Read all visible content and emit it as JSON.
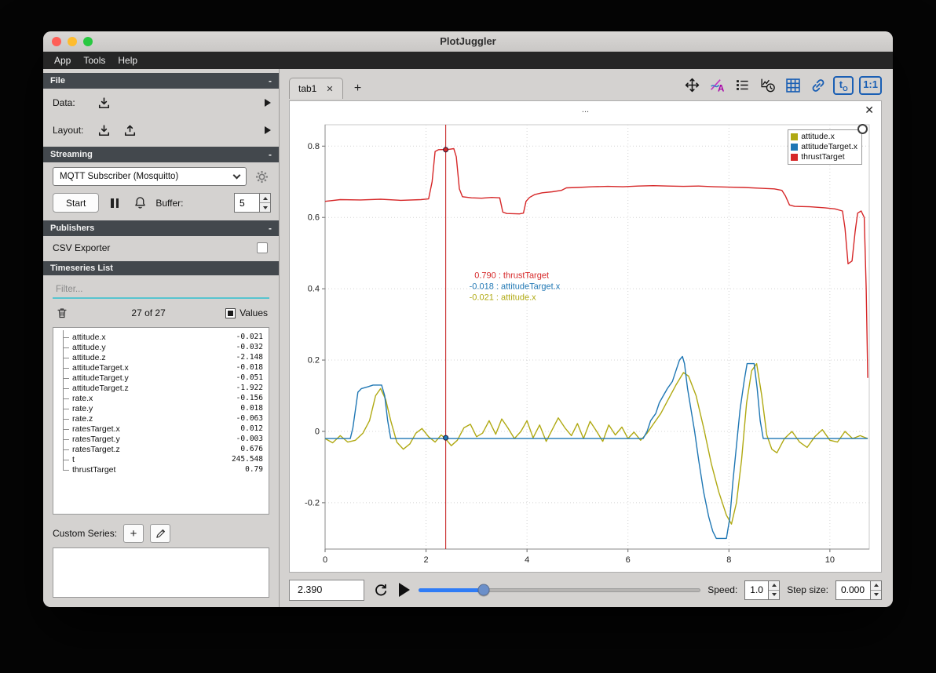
{
  "ui": {
    "collapse_symbol": "-",
    "close_symbol": "✕",
    "plus_symbol": "+",
    "plot_title": "..."
  },
  "window": {
    "title": "PlotJuggler",
    "menu_items": [
      "App",
      "Tools",
      "Help"
    ]
  },
  "sidebar": {
    "file_section": {
      "title": "File",
      "data_label": "Data:",
      "layout_label": "Layout:"
    },
    "streaming_section": {
      "title": "Streaming",
      "source_selected": "MQTT Subscriber (Mosquitto)",
      "start_button": "Start",
      "buffer_label": "Buffer:",
      "buffer_value": "5"
    },
    "publishers_section": {
      "title": "Publishers",
      "csv_exporter_label": "CSV Exporter"
    },
    "timeseries_section": {
      "title": "Timeseries List",
      "filter_placeholder": "Filter...",
      "count_text": "27 of 27",
      "values_label": "Values"
    },
    "series_list": [
      {
        "name": "attitude.x",
        "value": "-0.021"
      },
      {
        "name": "attitude.y",
        "value": "-0.032"
      },
      {
        "name": "attitude.z",
        "value": "-2.148"
      },
      {
        "name": "attitudeTarget.x",
        "value": "-0.018"
      },
      {
        "name": "attitudeTarget.y",
        "value": "-0.051"
      },
      {
        "name": "attitudeTarget.z",
        "value": "-1.922"
      },
      {
        "name": "rate.x",
        "value": "-0.156"
      },
      {
        "name": "rate.y",
        "value": "0.018"
      },
      {
        "name": "rate.z",
        "value": "-0.063"
      },
      {
        "name": "ratesTarget.x",
        "value": "0.012"
      },
      {
        "name": "ratesTarget.y",
        "value": "-0.003"
      },
      {
        "name": "ratesTarget.z",
        "value": "0.676"
      },
      {
        "name": "t",
        "value": "245.548"
      },
      {
        "name": "thrustTarget",
        "value": "0.79"
      }
    ],
    "custom_series_label": "Custom Series:"
  },
  "main": {
    "tab_label": "tab1"
  },
  "icons": {
    "t0_text": "t",
    "t0_sub": "O",
    "ratio_text": "1:1"
  },
  "playback": {
    "time_value": "2.390",
    "speed_label": "Speed:",
    "speed_value": "1.0",
    "step_label": "Step size:",
    "step_value": "0.000"
  },
  "chart_data": {
    "type": "line",
    "title": "...",
    "xlabel": "",
    "ylabel": "",
    "xlim": [
      0,
      10.78
    ],
    "ylim": [
      -0.33,
      0.86
    ],
    "xticks": [
      0,
      2,
      4,
      6,
      8,
      10
    ],
    "yticks": [
      -0.2,
      0,
      0.2,
      0.4,
      0.6,
      0.8
    ],
    "grid": true,
    "legend_position": "top-right",
    "legend": [
      {
        "name": "attitude.x",
        "color": "#b0a912"
      },
      {
        "name": "attitudeTarget.x",
        "color": "#1f77b4"
      },
      {
        "name": "thrustTarget",
        "color": "#d62728"
      }
    ],
    "tracker": {
      "x": 2.39,
      "labels": [
        {
          "text": "0.790 : thrustTarget",
          "color": "#d62728"
        },
        {
          "text": "-0.018 : attitudeTarget.x",
          "color": "#1f77b4"
        },
        {
          "text": "-0.021 : attitude.x",
          "color": "#b0a912"
        }
      ],
      "points": [
        {
          "y": 0.79,
          "color": "#d62728"
        },
        {
          "y": -0.018,
          "color": "#1f77b4"
        }
      ]
    },
    "series": [
      {
        "name": "attitude.x",
        "color": "#b0a912",
        "points": [
          [
            0,
            -0.02
          ],
          [
            0.15,
            -0.032
          ],
          [
            0.3,
            -0.012
          ],
          [
            0.45,
            -0.03
          ],
          [
            0.6,
            -0.025
          ],
          [
            0.75,
            -0.005
          ],
          [
            0.88,
            0.03
          ],
          [
            1.0,
            0.1
          ],
          [
            1.1,
            0.12
          ],
          [
            1.2,
            0.09
          ],
          [
            1.3,
            0.03
          ],
          [
            1.42,
            -0.03
          ],
          [
            1.55,
            -0.05
          ],
          [
            1.68,
            -0.035
          ],
          [
            1.8,
            -0.005
          ],
          [
            1.92,
            0.008
          ],
          [
            2.05,
            -0.015
          ],
          [
            2.18,
            -0.03
          ],
          [
            2.3,
            -0.01
          ],
          [
            2.39,
            -0.021
          ],
          [
            2.5,
            -0.04
          ],
          [
            2.62,
            -0.025
          ],
          [
            2.75,
            0.01
          ],
          [
            2.88,
            0.02
          ],
          [
            3.0,
            -0.015
          ],
          [
            3.12,
            -0.005
          ],
          [
            3.25,
            0.03
          ],
          [
            3.38,
            -0.008
          ],
          [
            3.5,
            0.035
          ],
          [
            3.62,
            0.01
          ],
          [
            3.75,
            -0.02
          ],
          [
            3.88,
            0.0
          ],
          [
            4.0,
            0.03
          ],
          [
            4.12,
            -0.018
          ],
          [
            4.25,
            0.018
          ],
          [
            4.38,
            -0.028
          ],
          [
            4.5,
            0.005
          ],
          [
            4.62,
            0.038
          ],
          [
            4.75,
            0.01
          ],
          [
            4.88,
            -0.012
          ],
          [
            5.0,
            0.022
          ],
          [
            5.12,
            -0.02
          ],
          [
            5.25,
            0.028
          ],
          [
            5.38,
            0.0
          ],
          [
            5.5,
            -0.028
          ],
          [
            5.62,
            0.018
          ],
          [
            5.75,
            -0.01
          ],
          [
            5.88,
            0.012
          ],
          [
            6.0,
            -0.02
          ],
          [
            6.12,
            -0.002
          ],
          [
            6.25,
            -0.025
          ],
          [
            6.38,
            -0.005
          ],
          [
            6.5,
            0.02
          ],
          [
            6.65,
            0.05
          ],
          [
            6.8,
            0.09
          ],
          [
            6.95,
            0.13
          ],
          [
            7.1,
            0.165
          ],
          [
            7.2,
            0.155
          ],
          [
            7.35,
            0.1
          ],
          [
            7.5,
            0.01
          ],
          [
            7.65,
            -0.09
          ],
          [
            7.8,
            -0.17
          ],
          [
            7.95,
            -0.235
          ],
          [
            8.05,
            -0.26
          ],
          [
            8.15,
            -0.2
          ],
          [
            8.25,
            -0.08
          ],
          [
            8.35,
            0.08
          ],
          [
            8.45,
            0.17
          ],
          [
            8.55,
            0.19
          ],
          [
            8.65,
            0.1
          ],
          [
            8.75,
            -0.01
          ],
          [
            8.85,
            -0.05
          ],
          [
            8.95,
            -0.06
          ],
          [
            9.1,
            -0.02
          ],
          [
            9.25,
            0.0
          ],
          [
            9.4,
            -0.03
          ],
          [
            9.55,
            -0.045
          ],
          [
            9.7,
            -0.015
          ],
          [
            9.85,
            0.005
          ],
          [
            10.0,
            -0.025
          ],
          [
            10.15,
            -0.03
          ],
          [
            10.3,
            0.0
          ],
          [
            10.45,
            -0.02
          ],
          [
            10.6,
            -0.012
          ],
          [
            10.75,
            -0.02
          ]
        ]
      },
      {
        "name": "attitudeTarget.x",
        "color": "#1f77b4",
        "points": [
          [
            0,
            -0.02
          ],
          [
            0.5,
            -0.02
          ],
          [
            0.55,
            0.01
          ],
          [
            0.6,
            0.06
          ],
          [
            0.65,
            0.11
          ],
          [
            0.72,
            0.12
          ],
          [
            0.85,
            0.125
          ],
          [
            0.95,
            0.13
          ],
          [
            1.12,
            0.13
          ],
          [
            1.18,
            0.1
          ],
          [
            1.24,
            0.03
          ],
          [
            1.3,
            -0.02
          ],
          [
            2.5,
            -0.02
          ],
          [
            4.0,
            -0.02
          ],
          [
            6.3,
            -0.02
          ],
          [
            6.38,
            0.0
          ],
          [
            6.45,
            0.03
          ],
          [
            6.55,
            0.05
          ],
          [
            6.62,
            0.08
          ],
          [
            6.7,
            0.1
          ],
          [
            6.78,
            0.12
          ],
          [
            6.88,
            0.14
          ],
          [
            6.95,
            0.17
          ],
          [
            7.02,
            0.2
          ],
          [
            7.08,
            0.21
          ],
          [
            7.12,
            0.19
          ],
          [
            7.18,
            0.12
          ],
          [
            7.25,
            0.06
          ],
          [
            7.32,
            0.0
          ],
          [
            7.4,
            -0.08
          ],
          [
            7.5,
            -0.17
          ],
          [
            7.6,
            -0.24
          ],
          [
            7.68,
            -0.28
          ],
          [
            7.75,
            -0.3
          ],
          [
            7.95,
            -0.3
          ],
          [
            8.02,
            -0.24
          ],
          [
            8.08,
            -0.14
          ],
          [
            8.15,
            -0.04
          ],
          [
            8.22,
            0.06
          ],
          [
            8.3,
            0.14
          ],
          [
            8.36,
            0.19
          ],
          [
            8.5,
            0.19
          ],
          [
            8.56,
            0.12
          ],
          [
            8.62,
            0.03
          ],
          [
            8.68,
            -0.02
          ],
          [
            10.75,
            -0.02
          ]
        ]
      },
      {
        "name": "thrustTarget",
        "color": "#d62728",
        "points": [
          [
            0,
            0.645
          ],
          [
            0.3,
            0.65
          ],
          [
            0.7,
            0.649
          ],
          [
            1.1,
            0.651
          ],
          [
            1.5,
            0.648
          ],
          [
            1.9,
            0.65
          ],
          [
            2.05,
            0.652
          ],
          [
            2.12,
            0.7
          ],
          [
            2.18,
            0.785
          ],
          [
            2.25,
            0.79
          ],
          [
            2.45,
            0.791
          ],
          [
            2.55,
            0.793
          ],
          [
            2.6,
            0.77
          ],
          [
            2.66,
            0.68
          ],
          [
            2.72,
            0.658
          ],
          [
            2.9,
            0.655
          ],
          [
            3.1,
            0.654
          ],
          [
            3.3,
            0.656
          ],
          [
            3.46,
            0.655
          ],
          [
            3.52,
            0.615
          ],
          [
            3.6,
            0.611
          ],
          [
            3.85,
            0.61
          ],
          [
            3.93,
            0.612
          ],
          [
            3.98,
            0.645
          ],
          [
            4.05,
            0.656
          ],
          [
            4.15,
            0.664
          ],
          [
            4.3,
            0.669
          ],
          [
            4.5,
            0.672
          ],
          [
            4.68,
            0.676
          ],
          [
            4.78,
            0.683
          ],
          [
            5.0,
            0.684
          ],
          [
            5.3,
            0.686
          ],
          [
            5.6,
            0.687
          ],
          [
            5.9,
            0.686
          ],
          [
            6.2,
            0.688
          ],
          [
            6.5,
            0.689
          ],
          [
            6.8,
            0.688
          ],
          [
            7.1,
            0.687
          ],
          [
            7.4,
            0.688
          ],
          [
            7.7,
            0.686
          ],
          [
            8.0,
            0.685
          ],
          [
            8.3,
            0.684
          ],
          [
            8.6,
            0.682
          ],
          [
            8.9,
            0.68
          ],
          [
            9.05,
            0.676
          ],
          [
            9.12,
            0.66
          ],
          [
            9.2,
            0.635
          ],
          [
            9.3,
            0.631
          ],
          [
            9.6,
            0.63
          ],
          [
            9.9,
            0.627
          ],
          [
            10.1,
            0.624
          ],
          [
            10.25,
            0.618
          ],
          [
            10.3,
            0.57
          ],
          [
            10.36,
            0.47
          ],
          [
            10.44,
            0.478
          ],
          [
            10.5,
            0.56
          ],
          [
            10.55,
            0.612
          ],
          [
            10.62,
            0.618
          ],
          [
            10.68,
            0.6
          ],
          [
            10.72,
            0.4
          ],
          [
            10.75,
            0.15
          ]
        ]
      }
    ]
  }
}
